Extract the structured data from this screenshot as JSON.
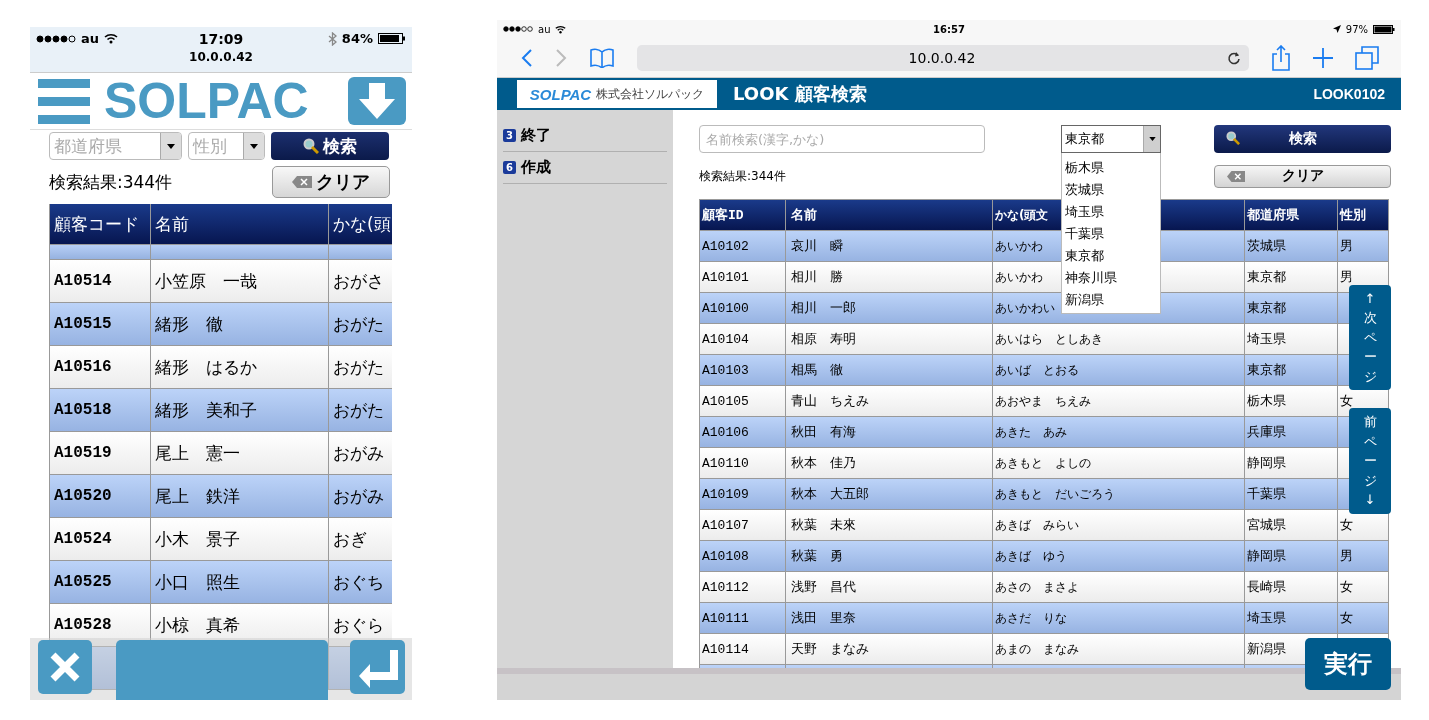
{
  "phone": {
    "status_bar": {
      "carrier": "au",
      "time": "17:09",
      "battery": "84%"
    },
    "url": "10.0.0.42",
    "brand": "SOLPAC",
    "filters": {
      "prefecture_placeholder": "都道府県",
      "gender_placeholder": "性別",
      "search_button": "検索"
    },
    "result_count": "検索結果:344件",
    "clear_button": "クリア",
    "table": {
      "columns": [
        "顧客コード",
        "名前",
        "かな(頭"
      ],
      "rows": [
        {
          "cells": [
            "A10514",
            "小笠原　一哉",
            "おがさ"
          ]
        },
        {
          "cells": [
            "A10515",
            "緒形　徹",
            "おがた"
          ]
        },
        {
          "cells": [
            "A10516",
            "緒形　はるか",
            "おがた"
          ]
        },
        {
          "cells": [
            "A10518",
            "緒形　美和子",
            "おがた"
          ]
        },
        {
          "cells": [
            "A10519",
            "尾上　憲一",
            "おがみ"
          ]
        },
        {
          "cells": [
            "A10520",
            "尾上　鉄洋",
            "おがみ"
          ]
        },
        {
          "cells": [
            "A10524",
            "小木　景子",
            "おぎ"
          ]
        },
        {
          "cells": [
            "A10525",
            "小口　照生",
            "おぐち"
          ]
        },
        {
          "cells": [
            "A10528",
            "小椋　真希",
            "おぐら"
          ]
        }
      ]
    }
  },
  "tablet": {
    "status_bar": {
      "carrier": "au",
      "time": "16:57",
      "battery": "97%"
    },
    "url": "10.0.0.42",
    "header": {
      "logo": "SOLPAC",
      "company": "株式会社ソルパック",
      "title": "LOOK 顧客検索",
      "screen_id": "LOOK0102"
    },
    "sidebar": {
      "items": [
        {
          "key": "3",
          "label": "終了"
        },
        {
          "key": "6",
          "label": "作成"
        }
      ]
    },
    "search": {
      "placeholder": "名前検索(漢字,かな)"
    },
    "prefecture_select": {
      "value": "東京都",
      "expanded": true,
      "options": [
        "栃木県",
        "茨城県",
        "埼玉県",
        "千葉県",
        "東京都",
        "神奈川県",
        "新潟県"
      ]
    },
    "search_button": "検索",
    "result_count": "検索結果:344件",
    "clear_button": "クリア",
    "table": {
      "columns": [
        "顧客ID",
        "名前",
        "かな(頭文",
        "都道府県",
        "性別"
      ],
      "rows": [
        {
          "cells": [
            "A10102",
            "哀川　瞬",
            "あいかわ",
            "茨城県",
            "男"
          ]
        },
        {
          "cells": [
            "A10101",
            "相川　勝",
            "あいかわ",
            "東京都",
            "男"
          ]
        },
        {
          "cells": [
            "A10100",
            "相川　一郎",
            "あいかわい",
            "東京都"
          ]
        },
        {
          "cells": [
            "A10104",
            "相原　寿明",
            "あいはら　としあき",
            "埼玉県"
          ]
        },
        {
          "cells": [
            "A10103",
            "相馬　徹",
            "あいば　とおる",
            "東京都"
          ]
        },
        {
          "cells": [
            "A10105",
            "青山　ちえみ",
            "あおやま　ちえみ",
            "栃木県",
            "女"
          ]
        },
        {
          "cells": [
            "A10106",
            "秋田　有海",
            "あきた　あみ",
            "兵庫県"
          ]
        },
        {
          "cells": [
            "A10110",
            "秋本　佳乃",
            "あきもと　よしの",
            "静岡県"
          ]
        },
        {
          "cells": [
            "A10109",
            "秋本　大五郎",
            "あきもと　だいごろう",
            "千葉県"
          ]
        },
        {
          "cells": [
            "A10107",
            "秋葉　未來",
            "あきば　みらい",
            "宮城県",
            "女"
          ]
        },
        {
          "cells": [
            "A10108",
            "秋葉　勇",
            "あきば　ゆう",
            "静岡県",
            "男"
          ]
        },
        {
          "cells": [
            "A10112",
            "浅野　昌代",
            "あさの　まさよ",
            "長崎県",
            "女"
          ]
        },
        {
          "cells": [
            "A10111",
            "浅田　里奈",
            "あさだ　りな",
            "埼玉県",
            "女"
          ]
        },
        {
          "cells": [
            "A10114",
            "天野　まなみ",
            "あまの　まなみ",
            "新潟県"
          ]
        }
      ]
    },
    "paging": {
      "next": "↑次ページ",
      "prev": "前ページ↓"
    },
    "run_button": "実行"
  }
}
